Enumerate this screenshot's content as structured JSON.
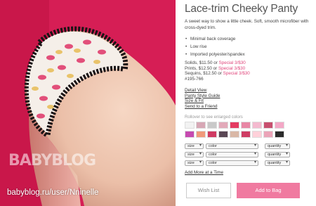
{
  "photo": {
    "watermark_logo": "BABYBLOG",
    "watermark_url": "babyblog.ru/user/Nninelle",
    "background_color": "#d61e55"
  },
  "product": {
    "title": "Lace-trim Cheeky Panty",
    "description": "A sweet way to show a little cheek. Soft, smooth microfiber with cross-dyed trim.",
    "features": [
      "Minimal back coverage",
      "Low rise",
      "Imported polyester/spandex"
    ],
    "prices": [
      {
        "text": "Solids, $11.50 or ",
        "special": "Special 3/$30"
      },
      {
        "text": "Prints, $12.50 or ",
        "special": "Special 3/$30"
      },
      {
        "text": "Sequins, $12.50 or ",
        "special": "Special 3/$30"
      }
    ],
    "item_number": "#195-766",
    "special_color": "#e0457b"
  },
  "links": {
    "detail_view": "Detail View",
    "style_guide": "Panty Style Guide",
    "size_fit": "Size & Fit",
    "send_friend": "Send to a Friend"
  },
  "swatches": {
    "hint": "Rollover to see enlarged colors",
    "colors": [
      "#f2f2f2",
      "#d7a7b5",
      "#c9c9c9",
      "#e2a9b9",
      "#e43b62",
      "#e887a5",
      "#f4b9cf",
      "#c8506f",
      "#f3a7c6",
      "#c64ab0",
      "#f09a7b",
      "#d03a62",
      "#5a4754",
      "#d9b7a6",
      "#cf3d64",
      "#ffd1da",
      "#eba4b8",
      "#2b2b2b"
    ]
  },
  "selects": {
    "size_label": "size",
    "color_label": "color",
    "quantity_label": "quantity",
    "rows": 3
  },
  "add_more": "Add More at a Time",
  "buttons": {
    "wish_list": "Wish List",
    "add_to_bag": "Add to Bag",
    "add_to_bag_color": "#f07aa0"
  }
}
